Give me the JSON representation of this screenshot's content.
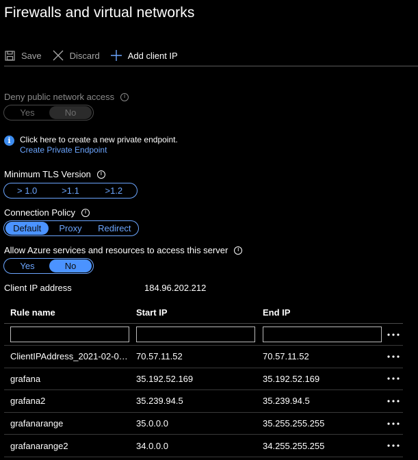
{
  "page": {
    "title": "Firewalls and virtual networks"
  },
  "toolbar": {
    "save_label": "Save",
    "discard_label": "Discard",
    "add_client_ip_label": "Add client IP"
  },
  "deny_public": {
    "label": "Deny public network access",
    "options": [
      "Yes",
      "No"
    ],
    "selected": "No",
    "enabled": false
  },
  "private_endpoint_banner": {
    "text": "Click here to create a new private endpoint.",
    "link": "Create Private Endpoint"
  },
  "tls": {
    "label": "Minimum TLS Version",
    "options": [
      "> 1.0",
      ">1.1",
      ">1.2"
    ]
  },
  "connection_policy": {
    "label": "Connection Policy",
    "options": [
      "Default",
      "Proxy",
      "Redirect"
    ],
    "selected": "Default"
  },
  "allow_azure": {
    "label": "Allow Azure services and resources to access this server",
    "options": [
      "Yes",
      "No"
    ],
    "selected": "No"
  },
  "client_ip": {
    "label": "Client IP address",
    "value": "184.96.202.212"
  },
  "rules_table": {
    "headers": [
      "Rule name",
      "Start IP",
      "End IP"
    ],
    "rows": [
      {
        "name": "ClientIPAddress_2021-02-01...",
        "start": "70.57.11.52",
        "end": "70.57.11.52"
      },
      {
        "name": "grafana",
        "start": "35.192.52.169",
        "end": "35.192.52.169"
      },
      {
        "name": "grafana2",
        "start": "35.239.94.5",
        "end": "35.239.94.5"
      },
      {
        "name": "grafanarange",
        "start": "35.0.0.0",
        "end": "35.255.255.255"
      },
      {
        "name": "grafanarange2",
        "start": "34.0.0.0",
        "end": "34.255.255.255"
      }
    ]
  },
  "colors": {
    "accent": "#4b93ff",
    "link": "#6ca6ff",
    "background": "#000000"
  }
}
